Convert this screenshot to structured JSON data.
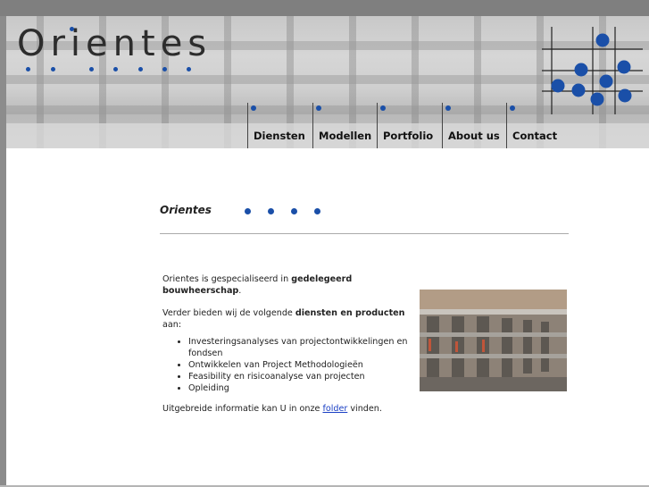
{
  "brand": {
    "name": "Orientes"
  },
  "nav": {
    "items": [
      {
        "label": "Diensten"
      },
      {
        "label": "Modellen"
      },
      {
        "label": "Portfolio"
      },
      {
        "label": "About us"
      },
      {
        "label": "Contact"
      }
    ]
  },
  "main": {
    "title": "Orientes",
    "intro_prefix": "Orientes is gespecialiseerd in ",
    "intro_bold": "gedelegeerd bouwheerschap",
    "intro_suffix": ".",
    "offer_prefix": "Verder bieden wij de volgende ",
    "offer_bold": "diensten en producten",
    "offer_suffix": " aan:",
    "services": [
      "Investeringsanalyses van projectontwikkelingen en fondsen",
      "Ontwikkelen van Project Methodologieën",
      "Feasibility en risicoanalyse van projecten",
      "Opleiding"
    ],
    "more_prefix": "Uitgebreide informatie kan U in onze ",
    "more_link": "folder",
    "more_suffix": " vinden."
  },
  "colors": {
    "accent": "#1a4fa8",
    "link": "#1a3fc4"
  }
}
